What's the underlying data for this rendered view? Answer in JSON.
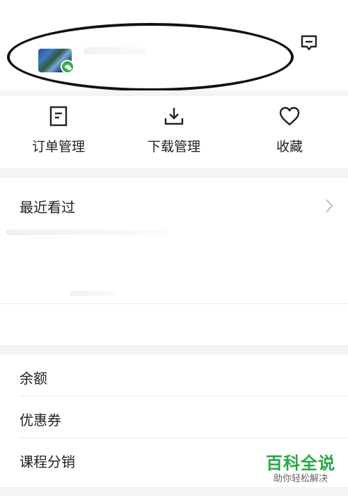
{
  "profile": {
    "avatar_icon": "wechat-avatar",
    "message_icon": "message-icon"
  },
  "quick_actions": [
    {
      "label": "订单管理",
      "icon": "order-document-icon"
    },
    {
      "label": "下载管理",
      "icon": "download-icon"
    },
    {
      "label": "收藏",
      "icon": "heart-icon"
    }
  ],
  "recent": {
    "title": "最近看过",
    "chevron_icon": "chevron-right-icon"
  },
  "menu": {
    "items": [
      {
        "label": "余额"
      },
      {
        "label": "优惠券"
      },
      {
        "label": "课程分销"
      }
    ]
  },
  "watermark": {
    "title": "百科全说",
    "subtitle": "助你轻松解决"
  },
  "colors": {
    "brand_green": "#27a844",
    "wechat_green": "#2bb24c",
    "section_gap": "#f4f4f4"
  }
}
